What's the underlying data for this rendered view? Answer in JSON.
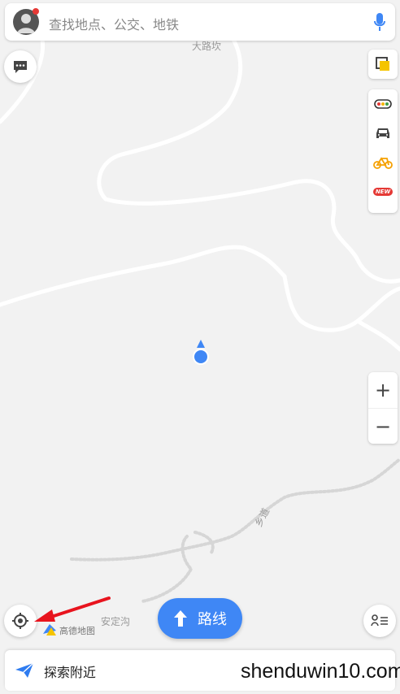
{
  "search": {
    "placeholder": "查找地点、公交、地铁"
  },
  "map": {
    "labels": {
      "top_place": "大路坎",
      "bottom_place": "安定沟",
      "road_label": "乡道"
    },
    "logo_text": "高德地图"
  },
  "toolbar": {
    "items": [
      {
        "name": "layers-icon"
      },
      {
        "name": "traffic-light-icon"
      },
      {
        "name": "taxi-icon"
      },
      {
        "name": "bike-icon"
      },
      {
        "name": "new-badge",
        "label": "NEW"
      }
    ]
  },
  "zoom": {
    "in": "+",
    "out": "−"
  },
  "route_button": {
    "label": "路线"
  },
  "bottom_bar": {
    "label": "探索附近"
  },
  "watermark": "shenduwin10.com",
  "colors": {
    "accent": "#3f87f5",
    "arrow": "#e8141e",
    "location_dot": "#3f87f5"
  }
}
